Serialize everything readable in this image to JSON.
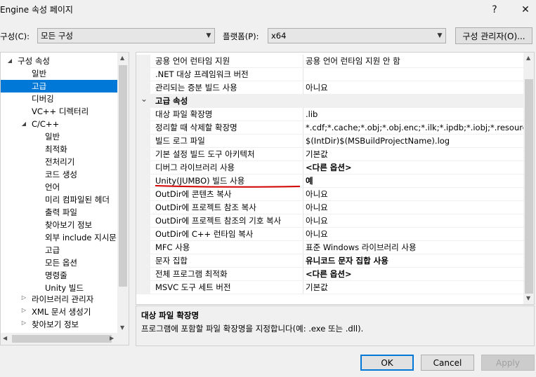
{
  "window": {
    "title": "Engine 속성 페이지",
    "help_glyph": "?",
    "close_glyph": "✕"
  },
  "toolbar": {
    "config_label": "구성(C):",
    "config_value": "모든 구성",
    "platform_label": "플랫폼(P):",
    "platform_value": "x64",
    "config_manager_label": "구성 관리자(O)..."
  },
  "tree": {
    "items": [
      {
        "label": "구성 속성",
        "expanded": true
      },
      {
        "label": "일반"
      },
      {
        "label": "고급",
        "selected": true
      },
      {
        "label": "디버깅"
      },
      {
        "label": "VC++ 디렉터리"
      },
      {
        "label": "C/C++",
        "expanded": true
      },
      {
        "label": "일반"
      },
      {
        "label": "최적화"
      },
      {
        "label": "전처리기"
      },
      {
        "label": "코드 생성"
      },
      {
        "label": "언어"
      },
      {
        "label": "미리 컴파일된 헤더"
      },
      {
        "label": "출력 파일"
      },
      {
        "label": "찾아보기 정보"
      },
      {
        "label": "외부 include 지시문"
      },
      {
        "label": "고급"
      },
      {
        "label": "모든 옵션"
      },
      {
        "label": "명령줄"
      },
      {
        "label": "Unity 빌드"
      },
      {
        "label": "라이브러리 관리자",
        "expanded": false
      },
      {
        "label": "XML 문서 생성기",
        "expanded": false
      },
      {
        "label": "찾아보기 정보",
        "expanded": false
      }
    ]
  },
  "grid": {
    "rows": [
      {
        "name": "공용 언어 런타임 지원",
        "value": "공용 언어 런타임 지원 안 함"
      },
      {
        "name": ".NET 대상 프레임워크 버전",
        "value": ""
      },
      {
        "name": "관리되는 증분 빌드 사용",
        "value": "아니요"
      },
      {
        "name": "고급 속성",
        "value": "",
        "category": true
      },
      {
        "name": "대상 파일 확장명",
        "value": ".lib"
      },
      {
        "name": "정리할 때 삭제할 확장명",
        "value": "*.cdf;*.cache;*.obj;*.obj.enc;*.ilk;*.ipdb;*.iobj;*.resources;*.tlb;*.tli;*.tlh;*.tmp"
      },
      {
        "name": "빌드 로그 파일",
        "value": "$(IntDir)$(MSBuildProjectName).log"
      },
      {
        "name": "기본 설정 빌드 도구 아키텍처",
        "value": "기본값"
      },
      {
        "name": "디버그 라이브러리 사용",
        "value": "<다른 옵션>",
        "bold": true
      },
      {
        "name": "Unity(JUMBO) 빌드 사용",
        "value": "예",
        "bold": true
      },
      {
        "name": "OutDir에 콘텐츠 복사",
        "value": "아니요"
      },
      {
        "name": "OutDir에 프로젝트 참조 복사",
        "value": "아니요"
      },
      {
        "name": "OutDir에 프로젝트 참조의 기호 복사",
        "value": "아니요"
      },
      {
        "name": "OutDir에 C++ 런타임 복사",
        "value": "아니요"
      },
      {
        "name": "MFC 사용",
        "value": "표준 Windows 라이브러리 사용"
      },
      {
        "name": "문자 집합",
        "value": "유니코드 문자 집합 사용",
        "bold": true
      },
      {
        "name": "전체 프로그램 최적화",
        "value": "<다른 옵션>",
        "bold": true
      },
      {
        "name": "MSVC 도구 세트 버전",
        "value": "기본값"
      }
    ]
  },
  "description": {
    "title": "대상 파일 확장명",
    "text": "프로그램에 포함할 파일 확장명을 지정합니다(예: .exe 또는 .dll)."
  },
  "buttons": {
    "ok": "OK",
    "cancel": "Cancel",
    "apply": "Apply"
  },
  "colors": {
    "selection": "#0078d7",
    "annotation": "#d40000"
  }
}
